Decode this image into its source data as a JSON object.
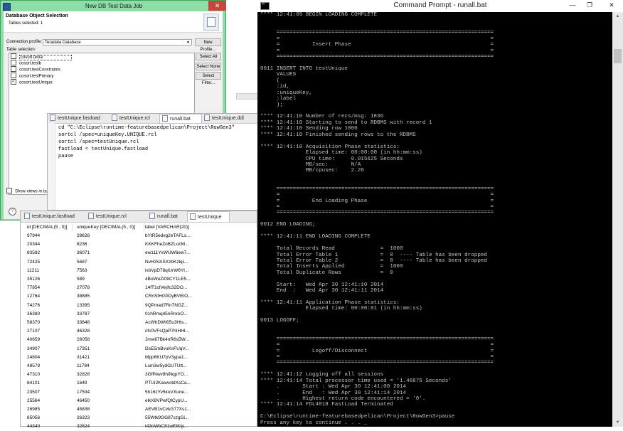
{
  "dialog": {
    "title": "New DB Test Data Job",
    "heading": "Database Object Selection",
    "subheading": "Tables selected: 1",
    "connection_label": "Connection profile:",
    "connection_value": "Teradata Database",
    "new_profile_label": "New Profile...",
    "table_selection_label": "Table selection:",
    "tables": [
      {
        "name": "cosort.testa",
        "checked": false
      },
      {
        "name": "cosort.testb",
        "checked": false
      },
      {
        "name": "cosort.testConstraints",
        "checked": false
      },
      {
        "name": "cosort.testPrimary",
        "checked": false
      },
      {
        "name": "cosort.testUnique",
        "checked": true
      }
    ],
    "select_all_label": "Select All",
    "select_none_label": "Select None",
    "select_filter_label": "Select Filter...",
    "show_views_label": "Show views in table"
  },
  "editor": {
    "tabs": [
      "testUnique.fastload",
      "testUnique.rcl",
      "runall.bat",
      "testUnique.ddl"
    ],
    "active_tab": 2,
    "lines": [
      "cd \"C:\\Eclipse\\runtime-featurebasedpelican\\Project\\RowGen3\"",
      "sortcl /spec=uniqueKey.UNIQUE.rcl",
      "sortcl /spec=testUnique.rcl",
      "fastload < testUnique.fastload",
      "pause"
    ]
  },
  "grid": {
    "tabs": [
      "testUnique.fastload",
      "testUnique.rcl",
      "runall.bat",
      "testUnique"
    ],
    "active_tab": 3,
    "columns": [
      "id [DECIMAL(5 , 0)]",
      "uniqueKey [DECIMAL(5 , 0)]",
      "label [VARCHAR(20)]"
    ],
    "rows": [
      [
        "97944",
        "28628",
        "bYtR5edvg2eTAFLs..."
      ],
      [
        "20344",
        "8236",
        "KKKFheZoBZLocM..."
      ],
      [
        "83582",
        "36071",
        "ew111YxWUW6ew7..."
      ],
      [
        "72425",
        "5687",
        "NvH3VASXzbKzlqL..."
      ],
      [
        "11211",
        "7563",
        "ixbVpD78qiUrW6YI..."
      ],
      [
        "35126",
        "589",
        "4BoWuZi09CY1LE5..."
      ],
      [
        "77854",
        "27078",
        "14fT1clVejifc32DO..."
      ],
      [
        "12764",
        "38885",
        "CRnStHG0DyBVEIO..."
      ],
      [
        "74276",
        "13395",
        "9QPmad7Rn7NGZ..."
      ],
      [
        "36380",
        "33787",
        "01hRmq45nRnreO..."
      ],
      [
        "58370",
        "33848",
        "AcWhDWI65u3Hts..."
      ],
      [
        "27107",
        "46328",
        "cfc0VFsQpP7hIHHI..."
      ],
      [
        "40659",
        "26058",
        "Jmw67Bk4nR6s5W..."
      ],
      [
        "34907",
        "17351",
        "DsE5mBvuKsFUqV..."
      ],
      [
        "24804",
        "31421",
        "Mpp6KU7pV3ypa1..."
      ],
      [
        "48579",
        "11784",
        "Lsm3w5ydGUTUtt..."
      ],
      [
        "47310",
        "32828",
        "3GffNwv8hiNqpYO..."
      ],
      [
        "64101",
        "1649",
        "PTUi2KaswstdXsCa..."
      ],
      [
        "23507",
        "17534",
        "5h16zYv5kuVXune..."
      ],
      [
        "25564",
        "46450",
        "elkX8VPwfQlCypU..."
      ],
      [
        "26985",
        "45838",
        "AEVB1vCvkG77Xs1..."
      ],
      [
        "85056",
        "26323",
        "55Wtk9OG87szgGi..."
      ],
      [
        "44340",
        "32624",
        "t43oWbC81wEIKtp..."
      ]
    ]
  },
  "cmd": {
    "title": "Command Prompt - runall.bat",
    "lines": [
      "**** 12:41:09 BEGIN LOADING COMPLETE",
      "",
      "",
      "     ===================================================================",
      "     =                                                                 =",
      "     =          Insert Phase                                           =",
      "     =                                                                 =",
      "     ===================================================================",
      "",
      "0011 INSERT INTO testUnique",
      "     VALUES",
      "     (",
      "     :id,",
      "     :uniqueKey,",
      "     :label",
      "     );",
      "",
      "**** 12:41:10 Number of recs/msg: 1836",
      "**** 12:41:10 Starting to send to RDBMS with record 1",
      "**** 12:41:10 Sending row 1000",
      "**** 12:41:10 Finished sending rows to the RDBMS",
      "",
      "**** 12:41:10 Acquisition Phase statistics:",
      "              Elapsed time: 00:00:00 (in hh:mm:ss)",
      "              CPU time:     0.015625 Seconds",
      "              MB/sec:       N/A",
      "              MB/cpusec:    2.26",
      "",
      "",
      "     ===================================================================",
      "     =                                                                 =",
      "     =          End Loading Phase                                      =",
      "     =                                                                 =",
      "     ===================================================================",
      "",
      "0012 END LOADING;",
      "",
      "**** 12:41:11 END LOADING COMPLETE",
      "",
      "     Total Records Read              =  1000",
      "     Total Error Table 1             =  0  ---- Table has been dropped",
      "     Total Error Table 2             =  0  ---- Table has been dropped",
      "     Total Inserts Applied           =  1000",
      "     Total Duplicate Rows            =  0",
      "",
      "     Start:   Wed Apr 30 12:41:10 2014",
      "     End  :   Wed Apr 30 12:41:11 2014",
      "",
      "**** 12:41:11 Application Phase statistics:",
      "              Elapsed time: 00:00:01 (in hh:mm:ss)",
      "",
      "0013 LOGOFF;",
      "",
      "",
      "     ===================================================================",
      "     =                                                                 =",
      "     =          Logoff/Disconnect                                      =",
      "     =                                                                 =",
      "     ===================================================================",
      "",
      "**** 12:41:12 Logging off all sessions",
      "**** 12:41:14 Total processor time used = '1.46875 Seconds'",
      "     .       Start : Wed Apr 30 12:41:00 2014",
      "     .       End   : Wed Apr 30 12:41:14 2014",
      "     .       Highest return code encountered = '0'.",
      "**** 12:41:14 FDL4818 FastLoad Terminated",
      "",
      "C:\\Eclipse\\runtime-featurebasedpelican\\Project\\RowGen3>pause",
      "Press any key to continue . . . _"
    ]
  }
}
